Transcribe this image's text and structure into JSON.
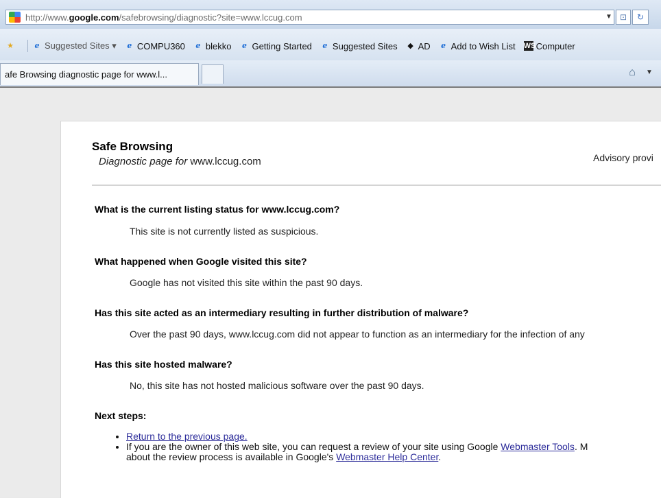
{
  "browser": {
    "url_prefix": "http://www.",
    "url_domain": "google.com",
    "url_path": "/safebrowsing/diagnostic?site=www.lccug.com",
    "favorites": [
      {
        "label": "Suggested Sites ▾",
        "icon": "ie-icon"
      },
      {
        "label": "COMPU360",
        "icon": "ie-icon"
      },
      {
        "label": "blekko",
        "icon": "ie-icon"
      },
      {
        "label": "Getting Started",
        "icon": "ie-icon"
      },
      {
        "label": "Suggested Sites",
        "icon": "ie-icon"
      },
      {
        "label": "AD",
        "icon": "cube-icon"
      },
      {
        "label": "Add to Wish List",
        "icon": "ie-icon"
      },
      {
        "label": "Computer",
        "icon": "ws-icon"
      }
    ],
    "tab_title": "afe Browsing diagnostic page for www.l..."
  },
  "page": {
    "title": "Safe Browsing",
    "subtitle_italic": "Diagnostic page for",
    "subtitle_site": " www.lccug.com",
    "advisory": "Advisory provi",
    "sections": [
      {
        "q": "What is the current listing status for www.lccug.com?",
        "a": "This site is not currently listed as suspicious."
      },
      {
        "q": "What happened when Google visited this site?",
        "a": "Google has not visited this site within the past 90 days."
      },
      {
        "q": "Has this site acted as an intermediary resulting in further distribution of malware?",
        "a": "Over the past 90 days, www.lccug.com did not appear to function as an intermediary for the infection of any"
      },
      {
        "q": "Has this site hosted malware?",
        "a": "No, this site has not hosted malicious software over the past 90 days."
      }
    ],
    "next_steps_label": "Next steps:",
    "step1_link": "Return to the previous page.",
    "step2_text_a": "If you are the owner of this web site, you can request a review of your site using Google ",
    "step2_link_a": "Webmaster Tools",
    "step2_text_b": ". M",
    "step2_text_c": "about the review process is available in Google's ",
    "step2_link_b": "Webmaster Help Center",
    "step2_text_d": "."
  }
}
